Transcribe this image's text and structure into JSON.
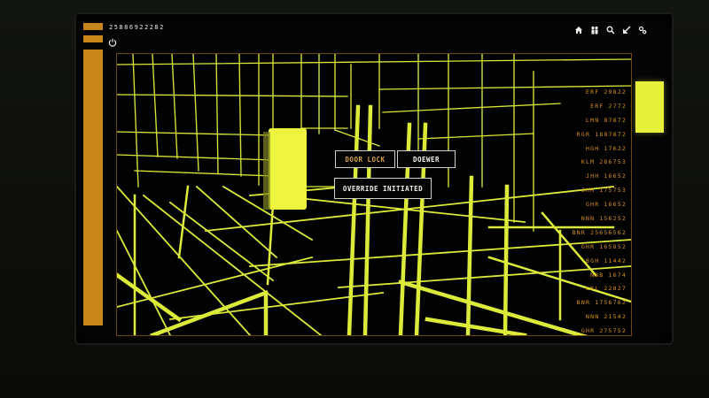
{
  "header": {
    "code_readout": "25886922282",
    "toolbar_icons": [
      "home-icon",
      "users-icon",
      "search-icon",
      "arrow-icon",
      "settings-icon"
    ]
  },
  "overlay": {
    "door_lock_label": "DOOR LOCK",
    "doewer_label": "DOEWER",
    "override_label": "OVERRIDE INITIATED"
  },
  "readouts": [
    "ERF  29822",
    "ERF  2772",
    "LMN  87872",
    "RGR  1887872",
    "HGH  17622",
    "KLM  286753",
    "JHH  16652",
    "JHH  175753",
    "GHR  16652",
    "NNN  156252",
    "BNR  25656562",
    "GHR  165852",
    "BGH  11442",
    "NBB  1674",
    "LKL  22827",
    "BNR  1756762",
    "NNN  21542",
    "GHR  275752"
  ],
  "colors": {
    "wireframe": "#dcea3a",
    "accent": "#c7861a",
    "readout_text": "#d9921c",
    "door": "#eef53f"
  }
}
